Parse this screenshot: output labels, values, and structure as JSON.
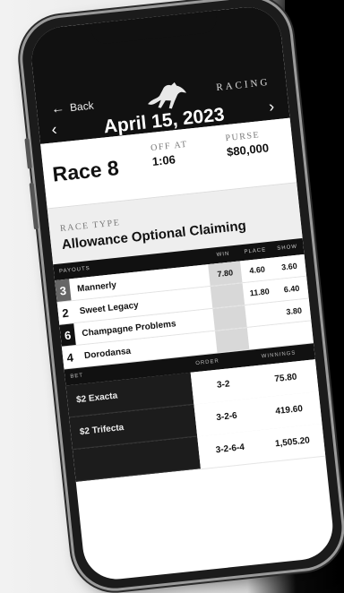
{
  "app": {
    "back_label": "Back",
    "brand": "RACING"
  },
  "date": "April 15, 2023",
  "race": {
    "number_label": "Race 8",
    "off_at_label": "OFF AT",
    "off_at": "1:06",
    "purse_label": "PURSE",
    "purse": "$80,000",
    "type_label": "RACE TYPE",
    "type": "Allowance Optional Claiming"
  },
  "payouts": {
    "header": "PAYOUTS",
    "columns": [
      "WIN",
      "PLACE",
      "SHOW"
    ],
    "rows": [
      {
        "num": "3",
        "num_bg": "#666666",
        "num_fg": "#ffffff",
        "name": "Mannerly",
        "win": "7.80",
        "place": "4.60",
        "show": "3.60"
      },
      {
        "num": "2",
        "num_bg": "#ffffff",
        "num_fg": "#111111",
        "name": "Sweet Legacy",
        "win": "",
        "place": "11.80",
        "show": "6.40"
      },
      {
        "num": "6",
        "num_bg": "#111111",
        "num_fg": "#ffffff",
        "name": "Champagne Problems",
        "win": "",
        "place": "",
        "show": "3.80"
      },
      {
        "num": "4",
        "num_bg": "#ffffff",
        "num_fg": "#111111",
        "name": "Dorodansa",
        "win": "",
        "place": "",
        "show": ""
      }
    ]
  },
  "bets": {
    "header": "BET",
    "order_label": "ORDER",
    "winnings_label": "WINNINGS",
    "rows": [
      {
        "name": "$2 Exacta",
        "order": "3-2",
        "winnings": "75.80"
      },
      {
        "name": "$2 Trifecta",
        "order": "3-2-6",
        "winnings": "419.60"
      },
      {
        "name": "",
        "order": "3-2-6-4",
        "winnings": "1,505.20"
      }
    ]
  }
}
